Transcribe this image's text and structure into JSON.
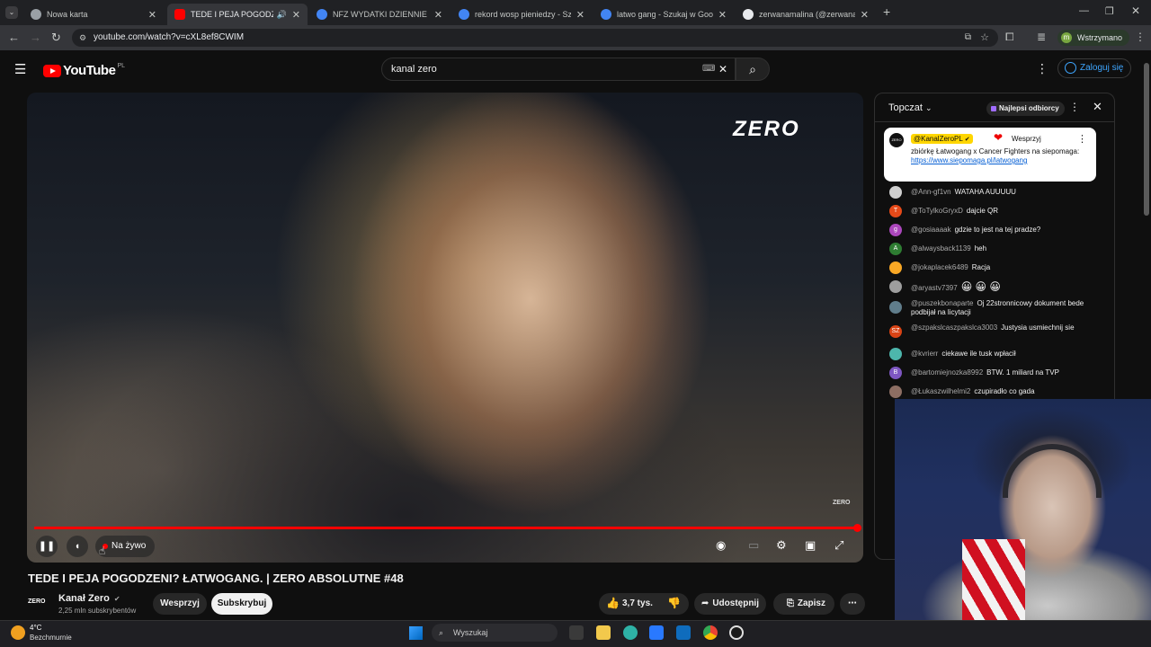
{
  "browser": {
    "tabs": [
      {
        "title": "Nowa karta",
        "favicon_color": "#9aa0a6"
      },
      {
        "title": "TEDE I PEJA POGODZENI? Ł",
        "favicon_color": "#ff0000"
      },
      {
        "title": "NFZ WYDATKI DZIENNIE - Szuk",
        "favicon_color": "#4285f4"
      },
      {
        "title": "rekord wosp pieniedzy - Szukaj",
        "favicon_color": "#4285f4"
      },
      {
        "title": "latwo gang - Szukaj w Google",
        "favicon_color": "#4285f4"
      },
      {
        "title": "zerwanamalina (@zerwanamali",
        "favicon_color": "#e8eaed"
      }
    ],
    "new_tab_label": "+",
    "url": "youtube.com/watch?v=cXL8ef8CWIM",
    "profile_initial": "m",
    "profile_status": "Wstrzymano"
  },
  "youtube": {
    "logo_text": "YouTube",
    "country_code": "PL",
    "search_value": "kanal zero",
    "signin_label": "Zaloguj się"
  },
  "player": {
    "watermark": "ZERO",
    "watermark_small": "ZERO",
    "progress_fraction": 1.0,
    "live_label": "Na żywo"
  },
  "video": {
    "title": "TEDE I PEJA POGODZENI? ŁATWOGANG. | ZERO ABSOLUTNE #48",
    "channel_name": "Kanał Zero",
    "channel_logo_text": "ZERO",
    "subscribers": "2,25 mln subskrybentów",
    "support_label": "Wesprzyj",
    "subscribe_label": "Subskrybuj",
    "likes": "3,7 tys.",
    "share_label": "Udostępnij",
    "save_label": "Zapisz"
  },
  "chat": {
    "mode_label": "Topczat",
    "top_donors_label": "Najlepsi odbiorcy",
    "pinned": {
      "author": "@KanalZeroPL",
      "avatar_text": "ZERO",
      "support_label": "Wesprzyj",
      "text": "zbiórkę Łatwogang x Cancer Fighters na siepomaga: ",
      "link": "https://www.siepomaga.pl/latwogang"
    },
    "messages": [
      {
        "author": "@Ann-gf1vn",
        "text": "WATAHA AUUUUU",
        "avatar_color": "#cfcfcf",
        "initial": ""
      },
      {
        "author": "@ToTylkoGryxD",
        "text": "dajcie QR",
        "avatar_color": "#e64a19",
        "initial": "T"
      },
      {
        "author": "@gosiaaaak",
        "text": "gdzie to jest na tej pradze?",
        "avatar_color": "#ab47bc",
        "initial": "g"
      },
      {
        "author": "@alwaysback1139",
        "text": "heh",
        "avatar_color": "#2e7d32",
        "initial": "A"
      },
      {
        "author": "@jokaplacek6489",
        "text": "Racja",
        "avatar_color": "#f9a825",
        "initial": ""
      },
      {
        "author": "@aryastv7397",
        "text": "😀 😀 😀",
        "avatar_color": "#9e9e9e",
        "initial": ""
      },
      {
        "author": "@puszekbonaparte",
        "text": "Oj 22stronnicowy dokument bede podbijał na licytacji",
        "avatar_color": "#607d8b",
        "initial": ""
      },
      {
        "author": "@szpakslcaszpakslca3003",
        "text": "Justysia usmiechnij sie",
        "avatar_color": "#d84315",
        "initial": "SZ"
      },
      {
        "author": "@kvrierr",
        "text": "ciekawe ile tusk wpłacił",
        "avatar_color": "#4db6ac",
        "initial": ""
      },
      {
        "author": "@bartomiejnozka8992",
        "text": "BTW. 1 miliard na TVP",
        "avatar_color": "#7e57c2",
        "initial": "B"
      },
      {
        "author": "@Łukaszwilhelmi2",
        "text": "czupiradło co gada",
        "avatar_color": "#8d6e63",
        "initial": ""
      }
    ]
  },
  "taskbar": {
    "temperature": "4°C",
    "weather": "Bezchmurnie",
    "search_placeholder": "Wyszukaj"
  }
}
